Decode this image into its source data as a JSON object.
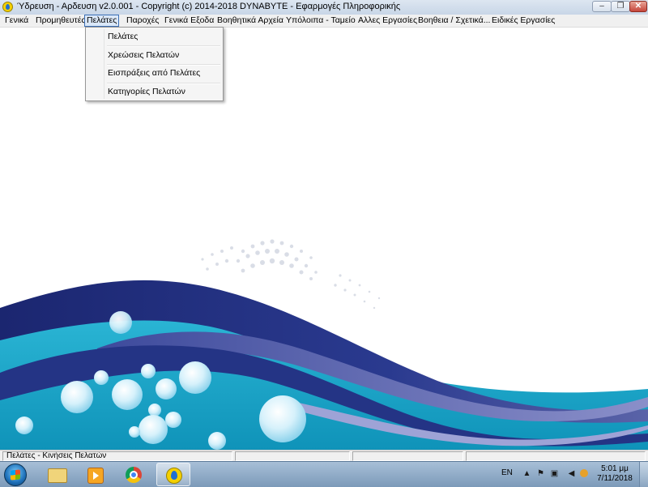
{
  "window": {
    "title": "Ύδρευση - Αρδευση  v2.0.001  -  Copyright (c) 2014-2018  DYNABYTE - Εφαρμογές Πληροφορικής",
    "minimize_glyph": "–",
    "maximize_glyph": "❐",
    "close_glyph": "✕"
  },
  "menubar": {
    "items": [
      {
        "label": "Γενικά"
      },
      {
        "label": "Προμηθευτές"
      },
      {
        "label": "Πελάτες"
      },
      {
        "label": "Παροχές"
      },
      {
        "label": "Γενικά Εξοδα"
      },
      {
        "label": "Βοηθητικά Αρχεία"
      },
      {
        "label": "Υπόλοιπα - Ταμείο"
      },
      {
        "label": "Αλλες Εργασίες"
      },
      {
        "label": "Βοηθεια / Σχετικά..."
      },
      {
        "label": "Ειδικές Εργασίες"
      }
    ],
    "active_index": 2
  },
  "dropdown": {
    "items": [
      {
        "label": "Πελάτες"
      },
      {
        "label": "Χρεώσεις Πελατών"
      },
      {
        "label": "Εισπράξεις από Πελάτες"
      },
      {
        "label": "Κατηγορίες Πελατών"
      }
    ]
  },
  "statusbar": {
    "panels": [
      {
        "text": "Πελάτες - Κινήσεις Πελατών"
      },
      {
        "text": ""
      },
      {
        "text": ""
      },
      {
        "text": ""
      }
    ]
  },
  "taskbar": {
    "apps": [
      {
        "icon": "windows-explorer-icon"
      },
      {
        "icon": "media-player-icon"
      },
      {
        "icon": "chrome-icon"
      },
      {
        "icon": "water-app-icon",
        "active": true
      }
    ],
    "tray": {
      "language": "EN",
      "icons": [
        "show-hidden-icons",
        "action-center-flag-icon",
        "network-icon",
        "volume-icon",
        "app-tray-icon"
      ],
      "time": "5:01 μμ",
      "date": "7/11/2018"
    }
  },
  "colors": {
    "wave_navy": "#1f2f7c",
    "wave_purple": "#6b6fb3",
    "wave_cyan": "#17a3c6",
    "menu_highlight": "#3b6fb6"
  }
}
